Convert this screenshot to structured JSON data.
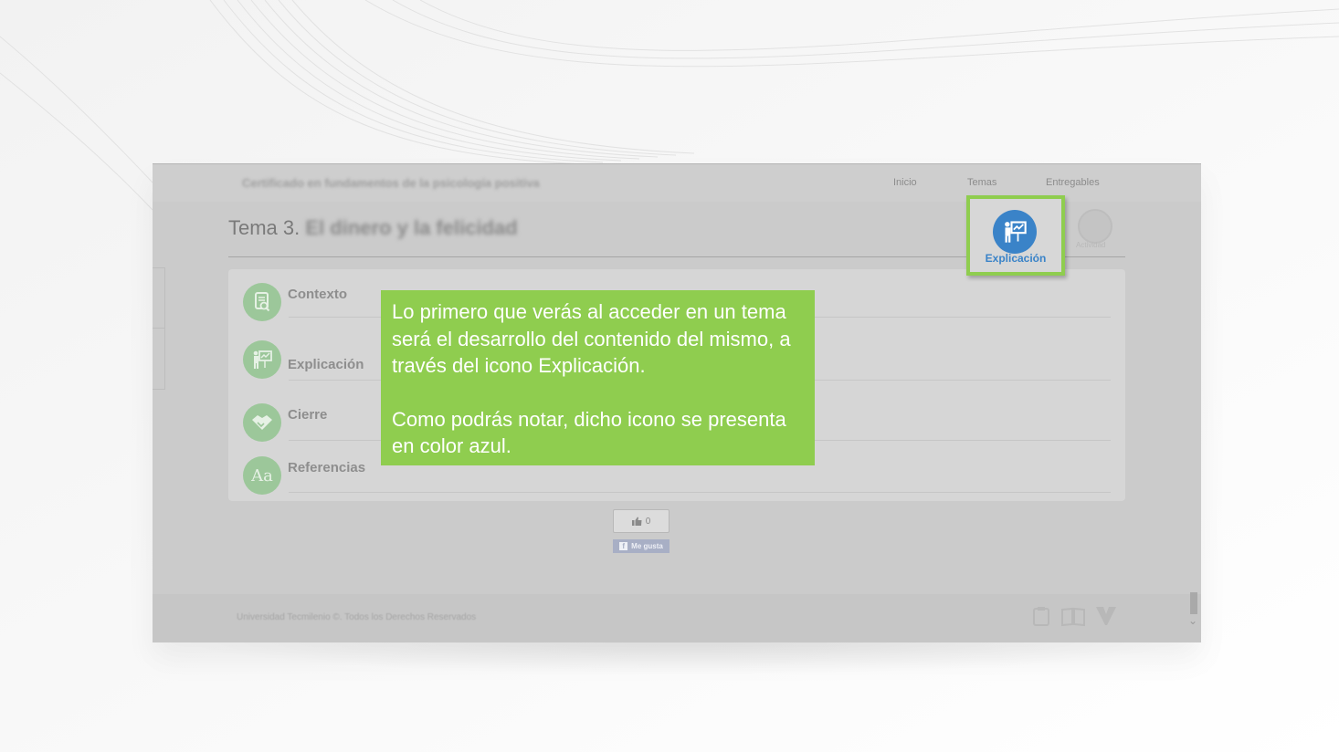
{
  "course_title": "Certificado en fundamentos de la psicología positiva",
  "nav": {
    "inicio": "Inicio",
    "temas": "Temas",
    "entregables": "Entregables"
  },
  "topic": {
    "prefix": "Tema 3.",
    "name": "El dinero y la felicidad"
  },
  "menu": [
    {
      "label": "Contexto",
      "icon": "document-magnifier-icon"
    },
    {
      "label": "Explicación",
      "icon": "presenter-board-icon"
    },
    {
      "label": "Cierre",
      "icon": "handshake-icon"
    },
    {
      "label": "Referencias",
      "icon": "Aa-icon",
      "glyph": "Aa"
    }
  ],
  "callout": {
    "paragraph1": "Lo primero que verás al acceder en un tema será el desarrollo del contenido del mismo, a través del icono Explicación.",
    "paragraph2": "Como podrás notar, dicho icono se presenta en color azul."
  },
  "highlight": {
    "label": "Explicación",
    "icon": "presenter-board-icon",
    "color": "#3a83c8"
  },
  "faded_tab": {
    "label": "Actividad"
  },
  "like": {
    "count": "0",
    "button_label": "Me gusta"
  },
  "footer": {
    "copyright": "Universidad Tecmilenio ©. Todos los Derechos Reservados"
  },
  "colors": {
    "callout_bg": "#8fcd4f",
    "accent_blue": "#3a83c8",
    "menu_icon_green": "#9cc79a"
  }
}
